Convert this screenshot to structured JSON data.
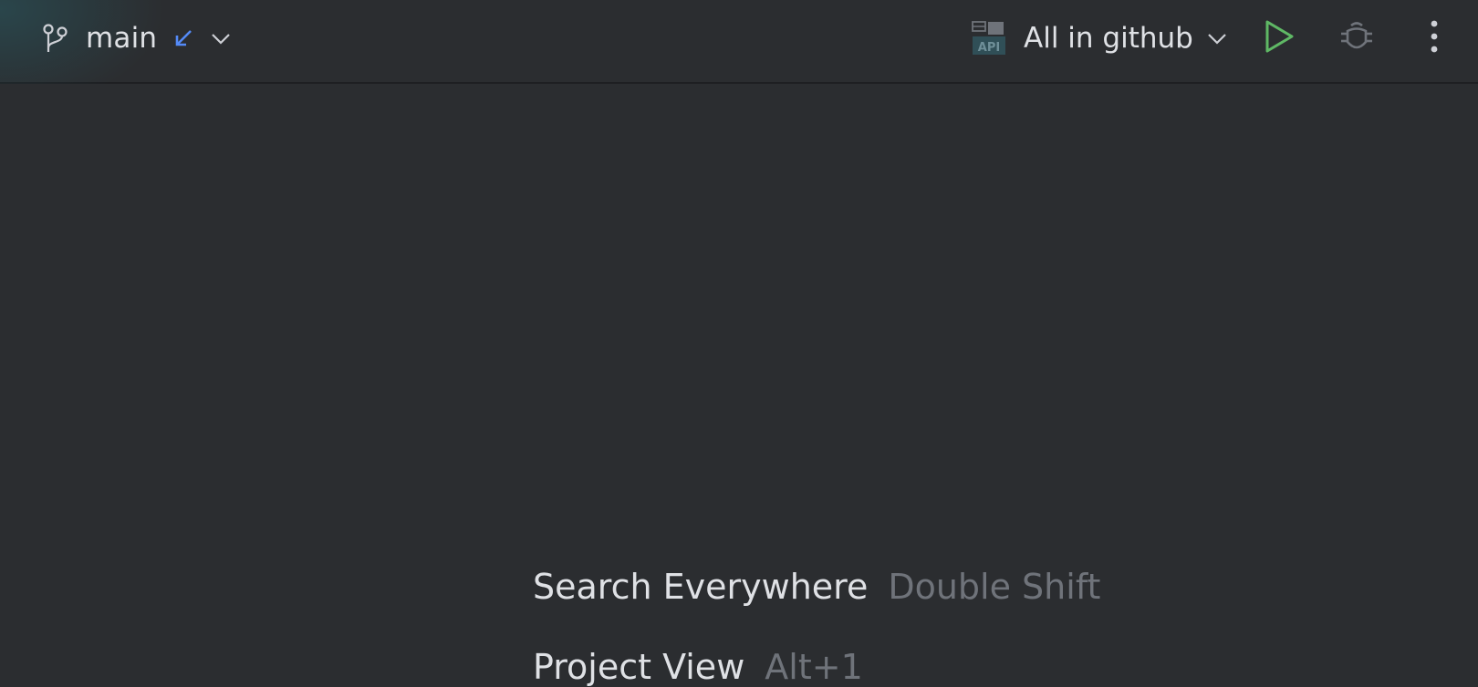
{
  "toolbar": {
    "branch": {
      "name": "main",
      "icon": "git-branch-icon",
      "incoming_icon": "incoming-changes-arrow-icon",
      "dropdown_icon": "chevron-down-icon"
    },
    "run_configuration": {
      "label": "All in github",
      "icon": "api-icon",
      "dropdown_icon": "chevron-down-icon"
    },
    "actions": [
      {
        "name": "run",
        "icon": "run-icon",
        "color": "#5fb865"
      },
      {
        "name": "debug",
        "icon": "debug-icon",
        "color": "#6f737a"
      },
      {
        "name": "more",
        "icon": "more-vertical-icon"
      }
    ]
  },
  "editor": {
    "empty_state_hints": [
      {
        "action": "Search Everywhere",
        "shortcut": "Double Shift"
      },
      {
        "action": "Project View",
        "shortcut": "Alt+1"
      }
    ]
  },
  "colors": {
    "background": "#2b2d30",
    "text_primary": "#dfe1e5",
    "text_secondary": "#6f737a",
    "accent_blue": "#548af7",
    "run_green": "#5fb865"
  }
}
